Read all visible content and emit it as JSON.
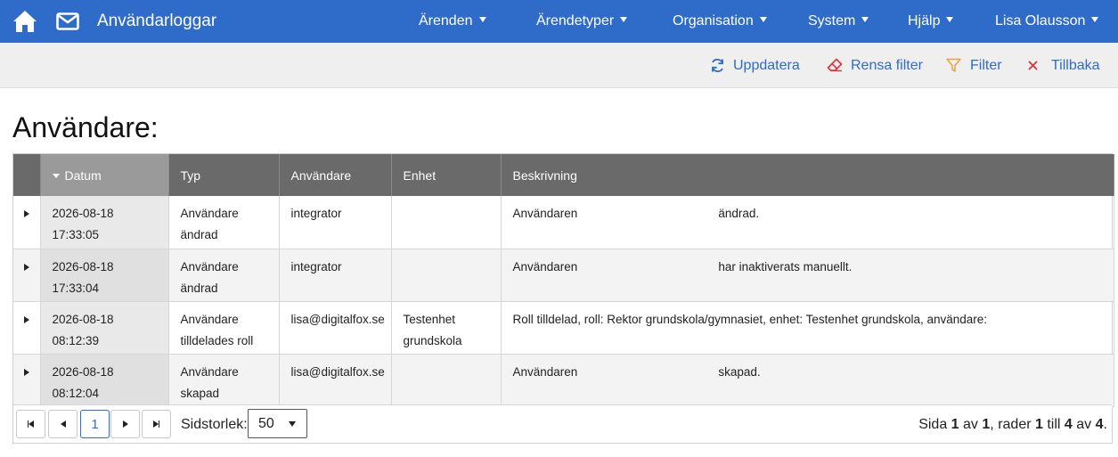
{
  "app": {
    "title": "Användarloggar"
  },
  "nav": {
    "menus": [
      "Ärenden",
      "Ärendetyper",
      "Organisation",
      "System",
      "Hjälp",
      "Lisa Olausson"
    ]
  },
  "toolbar": {
    "refresh": "Uppdatera",
    "clear_filter": "Rensa filter",
    "filter": "Filter",
    "back": "Tillbaka"
  },
  "page": {
    "title": "Användare:"
  },
  "table": {
    "columns": [
      "Datum",
      "Typ",
      "Användare",
      "Enhet",
      "Beskrivning"
    ],
    "sorted_column": "Datum",
    "rows": [
      {
        "date": "2026-08-18 17:33:05",
        "type": "Användare ändrad",
        "user": "integrator",
        "unit": "",
        "desc_start": "Användaren",
        "desc_end": "ändrad."
      },
      {
        "date": "2026-08-18 17:33:04",
        "type": "Användare ändrad",
        "user": "integrator",
        "unit": "",
        "desc_start": "Användaren",
        "desc_end": "har inaktiverats manuellt."
      },
      {
        "date": "2026-08-18 08:12:39",
        "type": "Användare tilldelades roll",
        "user": "lisa@digitalfox.se",
        "unit": "Testenhet grundskola",
        "desc_start": "Roll tilldelad, roll: Rektor grundskola/gymnasiet, enhet: Testenhet grundskola, användare:",
        "desc_end": ""
      },
      {
        "date": "2026-08-18 08:12:04",
        "type": "Användare skapad",
        "user": "lisa@digitalfox.se",
        "unit": "",
        "desc_start": "Användaren",
        "desc_end": "skapad."
      }
    ]
  },
  "pager": {
    "current_page": "1",
    "page_size_label": "Sidstorlek:",
    "page_size": "50",
    "info": {
      "w1": "Sida",
      "page": "1",
      "w2": "av",
      "pages": "1",
      "w3": ", rader",
      "from": "1",
      "w4": "till",
      "to": "4",
      "w5": "av",
      "total": "4",
      "end": "."
    }
  },
  "colors": {
    "nav": "#2f6bc8",
    "header": "#6a6a6a",
    "sorted_header": "#9a9a9a",
    "link": "#2f6bc8",
    "danger": "#d9343a",
    "filter": "#e8a33d"
  },
  "icons": [
    "home-icon",
    "mail-icon",
    "refresh-icon",
    "eraser-icon",
    "filter-icon",
    "close-icon"
  ]
}
